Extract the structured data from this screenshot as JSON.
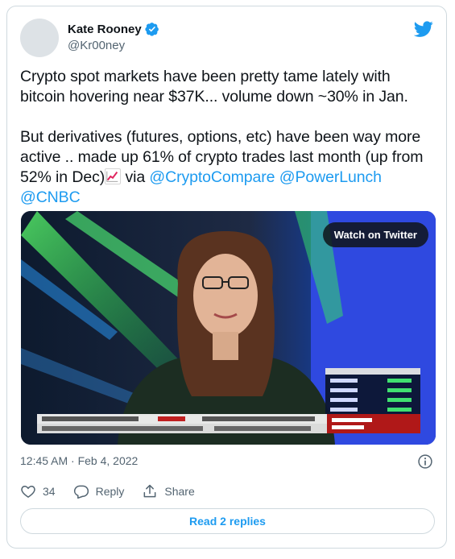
{
  "author": {
    "name": "Kate Rooney",
    "handle": "@Kr00ney"
  },
  "tweet": {
    "line1": "Crypto spot markets have been pretty tame lately with bitcoin hovering near $37K...  volume down ~30% in Jan.",
    "line2_start": "But derivatives (futures, options, etc) have been way more active .. made up 61% of crypto trades last month (up from 52% in Dec)",
    "line2_via": " via ",
    "mention1": "@CryptoCompare",
    "mention2": "@PowerLunch",
    "mention3": "@CNBC"
  },
  "media": {
    "watch_label": "Watch on Twitter"
  },
  "timestamp": "12:45 AM · Feb 4, 2022",
  "actions": {
    "like_count": "34",
    "reply_label": "Reply",
    "share_label": "Share"
  },
  "read_replies_label": "Read 2 replies",
  "colors": {
    "accent": "#1d9bf0",
    "text": "#0f1419",
    "muted": "#536471",
    "border": "#cfd9de"
  }
}
